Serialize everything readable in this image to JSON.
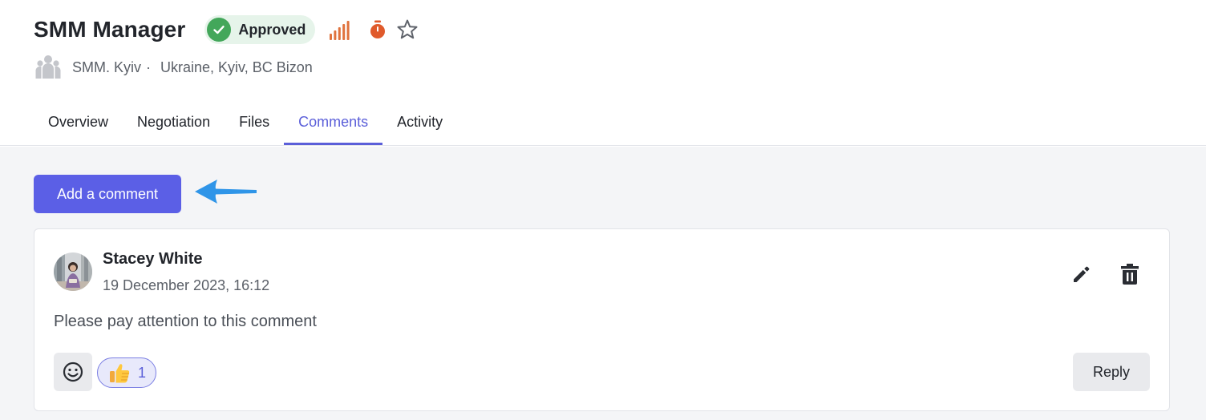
{
  "header": {
    "title": "SMM Manager",
    "status": {
      "label": "Approved",
      "color": "#43a75a",
      "background": "#e6f4ea"
    },
    "icons": {
      "priority": "signal-bars-icon",
      "timer": "timer-icon",
      "favorite": "star-outline-icon"
    },
    "priority_color": "#e0723c",
    "timer_color": "#e05a2b"
  },
  "meta": {
    "department": "SMM. Kyiv",
    "separator": "·",
    "location": "Ukraine, Kyiv, BC Bizon",
    "icon": "group-icon"
  },
  "tabs": [
    {
      "label": "Overview",
      "active": false
    },
    {
      "label": "Negotiation",
      "active": false
    },
    {
      "label": "Files",
      "active": false
    },
    {
      "label": "Comments",
      "active": true
    },
    {
      "label": "Activity",
      "active": false
    }
  ],
  "accent_color": "#5b5fe6",
  "actions": {
    "add_comment_label": "Add a comment"
  },
  "comment": {
    "author": "Stacey White",
    "date": "19 December 2023, 16:12",
    "text": "Please pay attention to this comment",
    "reaction": {
      "emoji": "thumbs-up",
      "count": "1"
    },
    "reply_label": "Reply",
    "icons": {
      "edit": "pencil-icon",
      "delete": "trash-icon",
      "emoji": "smiley-icon"
    }
  }
}
